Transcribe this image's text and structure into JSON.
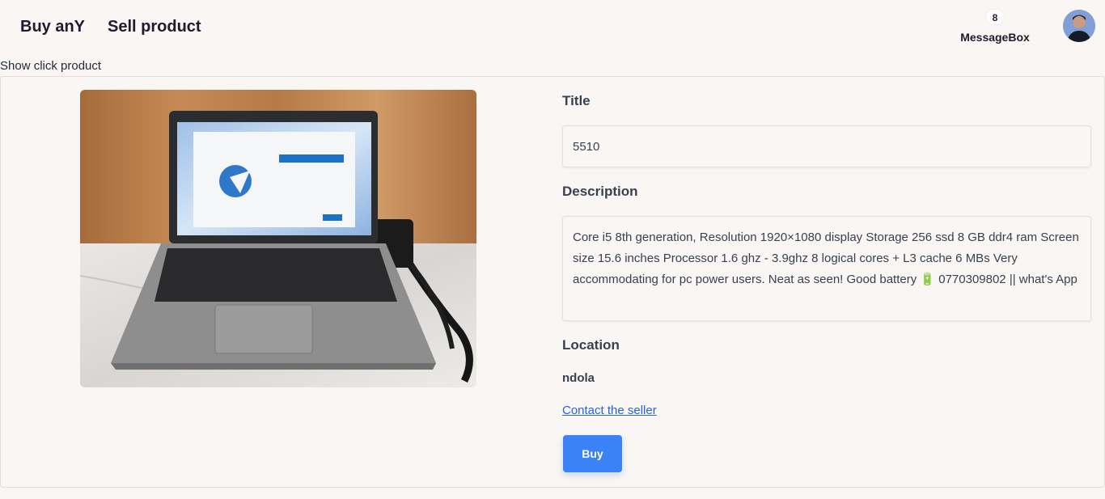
{
  "nav": {
    "buy_label": "Buy anY",
    "sell_label": "Sell product",
    "message_count": "8",
    "message_label": "MessageBox"
  },
  "page": {
    "caption": "Show click product"
  },
  "product": {
    "title_label": "Title",
    "title_value": "5510",
    "description_label": "Description",
    "description_value": "Core i5 8th generation, Resolution 1920×1080 display Storage 256 ssd 8 GB ddr4 ram Screen size 15.6 inches Processor 1.6 ghz - 3.9ghz 8 logical cores + L3 cache 6 MBs Very accommodating for pc power users. Neat as seen! Good battery 🔋 0770309802 || what's App",
    "location_label": "Location",
    "location_value": "ndola",
    "contact_label": "Contact the seller",
    "buy_label": "Buy"
  },
  "colors": {
    "background": "#faf6f3",
    "accent": "#3b82f6",
    "link": "#2563eb"
  }
}
